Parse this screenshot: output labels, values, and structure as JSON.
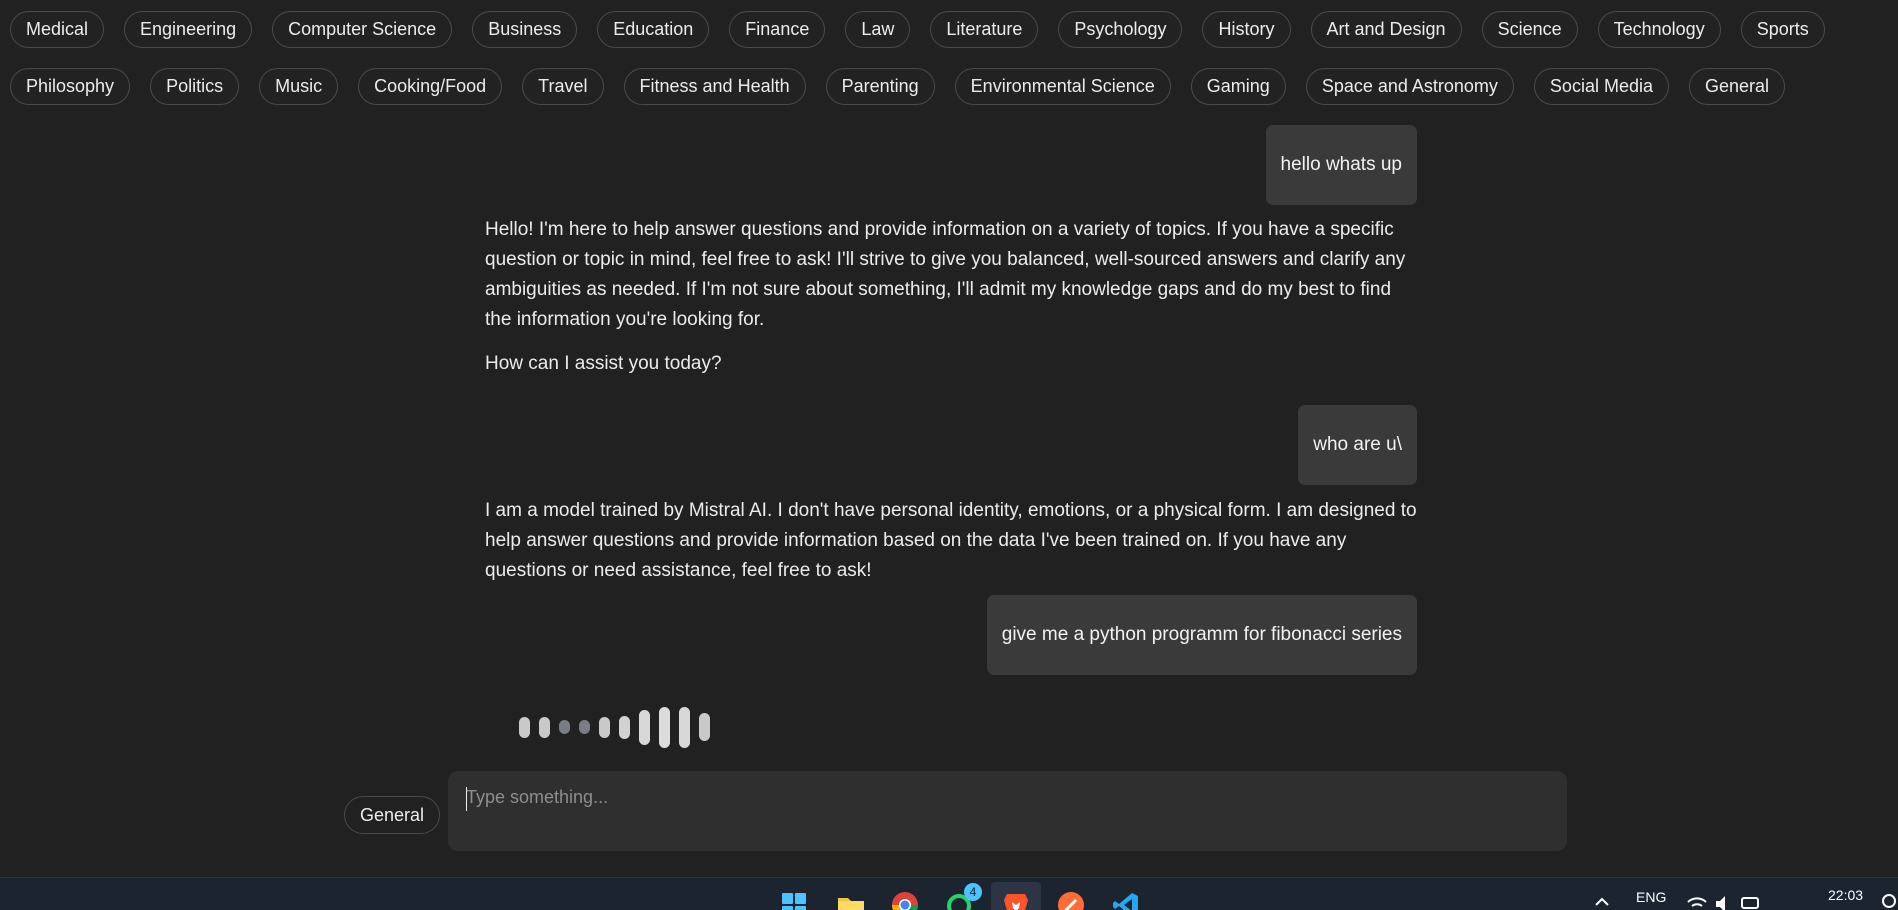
{
  "topics_row1": [
    "Medical",
    "Engineering",
    "Computer Science",
    "Business",
    "Education",
    "Finance",
    "Law",
    "Literature",
    "Psychology",
    "History",
    "Art and Design",
    "Science",
    "Technology",
    "Sports"
  ],
  "topics_row2": [
    "Philosophy",
    "Politics",
    "Music",
    "Cooking/Food",
    "Travel",
    "Fitness and Health",
    "Parenting",
    "Environmental Science",
    "Gaming",
    "Space and Astronomy",
    "Social Media",
    "General"
  ],
  "messages": [
    {
      "role": "user",
      "text": "hello whats up"
    },
    {
      "role": "assistant",
      "paragraphs": [
        "Hello! I'm here to help answer questions and provide information on a variety of topics. If you have a specific question or topic in mind, feel free to ask! I'll strive to give you balanced, well-sourced answers and clarify any ambiguities as needed. If I'm not sure about something, I'll admit my knowledge gaps and do my best to find the information you're looking for.",
        "How can I assist you today?"
      ]
    },
    {
      "role": "user",
      "text": "who are u\\"
    },
    {
      "role": "assistant",
      "paragraphs": [
        "I am a model trained by Mistral AI. I don't have personal identity, emotions, or a physical form. I am designed to help answer questions and provide information based on the data I've been trained on. If you have any questions or need assistance, feel free to ask!"
      ]
    },
    {
      "role": "user",
      "text": "give me a python programm for fibonacci series"
    }
  ],
  "loading_indicator": {
    "levels": [
      0.45,
      0.45,
      0.3,
      0.3,
      0.45,
      0.5,
      0.75,
      0.9,
      0.9,
      0.6
    ]
  },
  "composer": {
    "model_label": "General",
    "placeholder": "Type something...",
    "value": ""
  },
  "taskbar": {
    "apps": [
      "windows-start-icon",
      "file-explorer-icon",
      "chrome-icon",
      "whatsapp-icon",
      "brave-icon",
      "postman-icon",
      "vscode-icon"
    ],
    "whatsapp_badge": "4",
    "language": "ENG",
    "time": "22:03"
  },
  "colors": {
    "background": "#212121",
    "user_bubble": "#3a3a3a",
    "composer": "#2f2f2f",
    "taskbar": "#1c2430"
  }
}
